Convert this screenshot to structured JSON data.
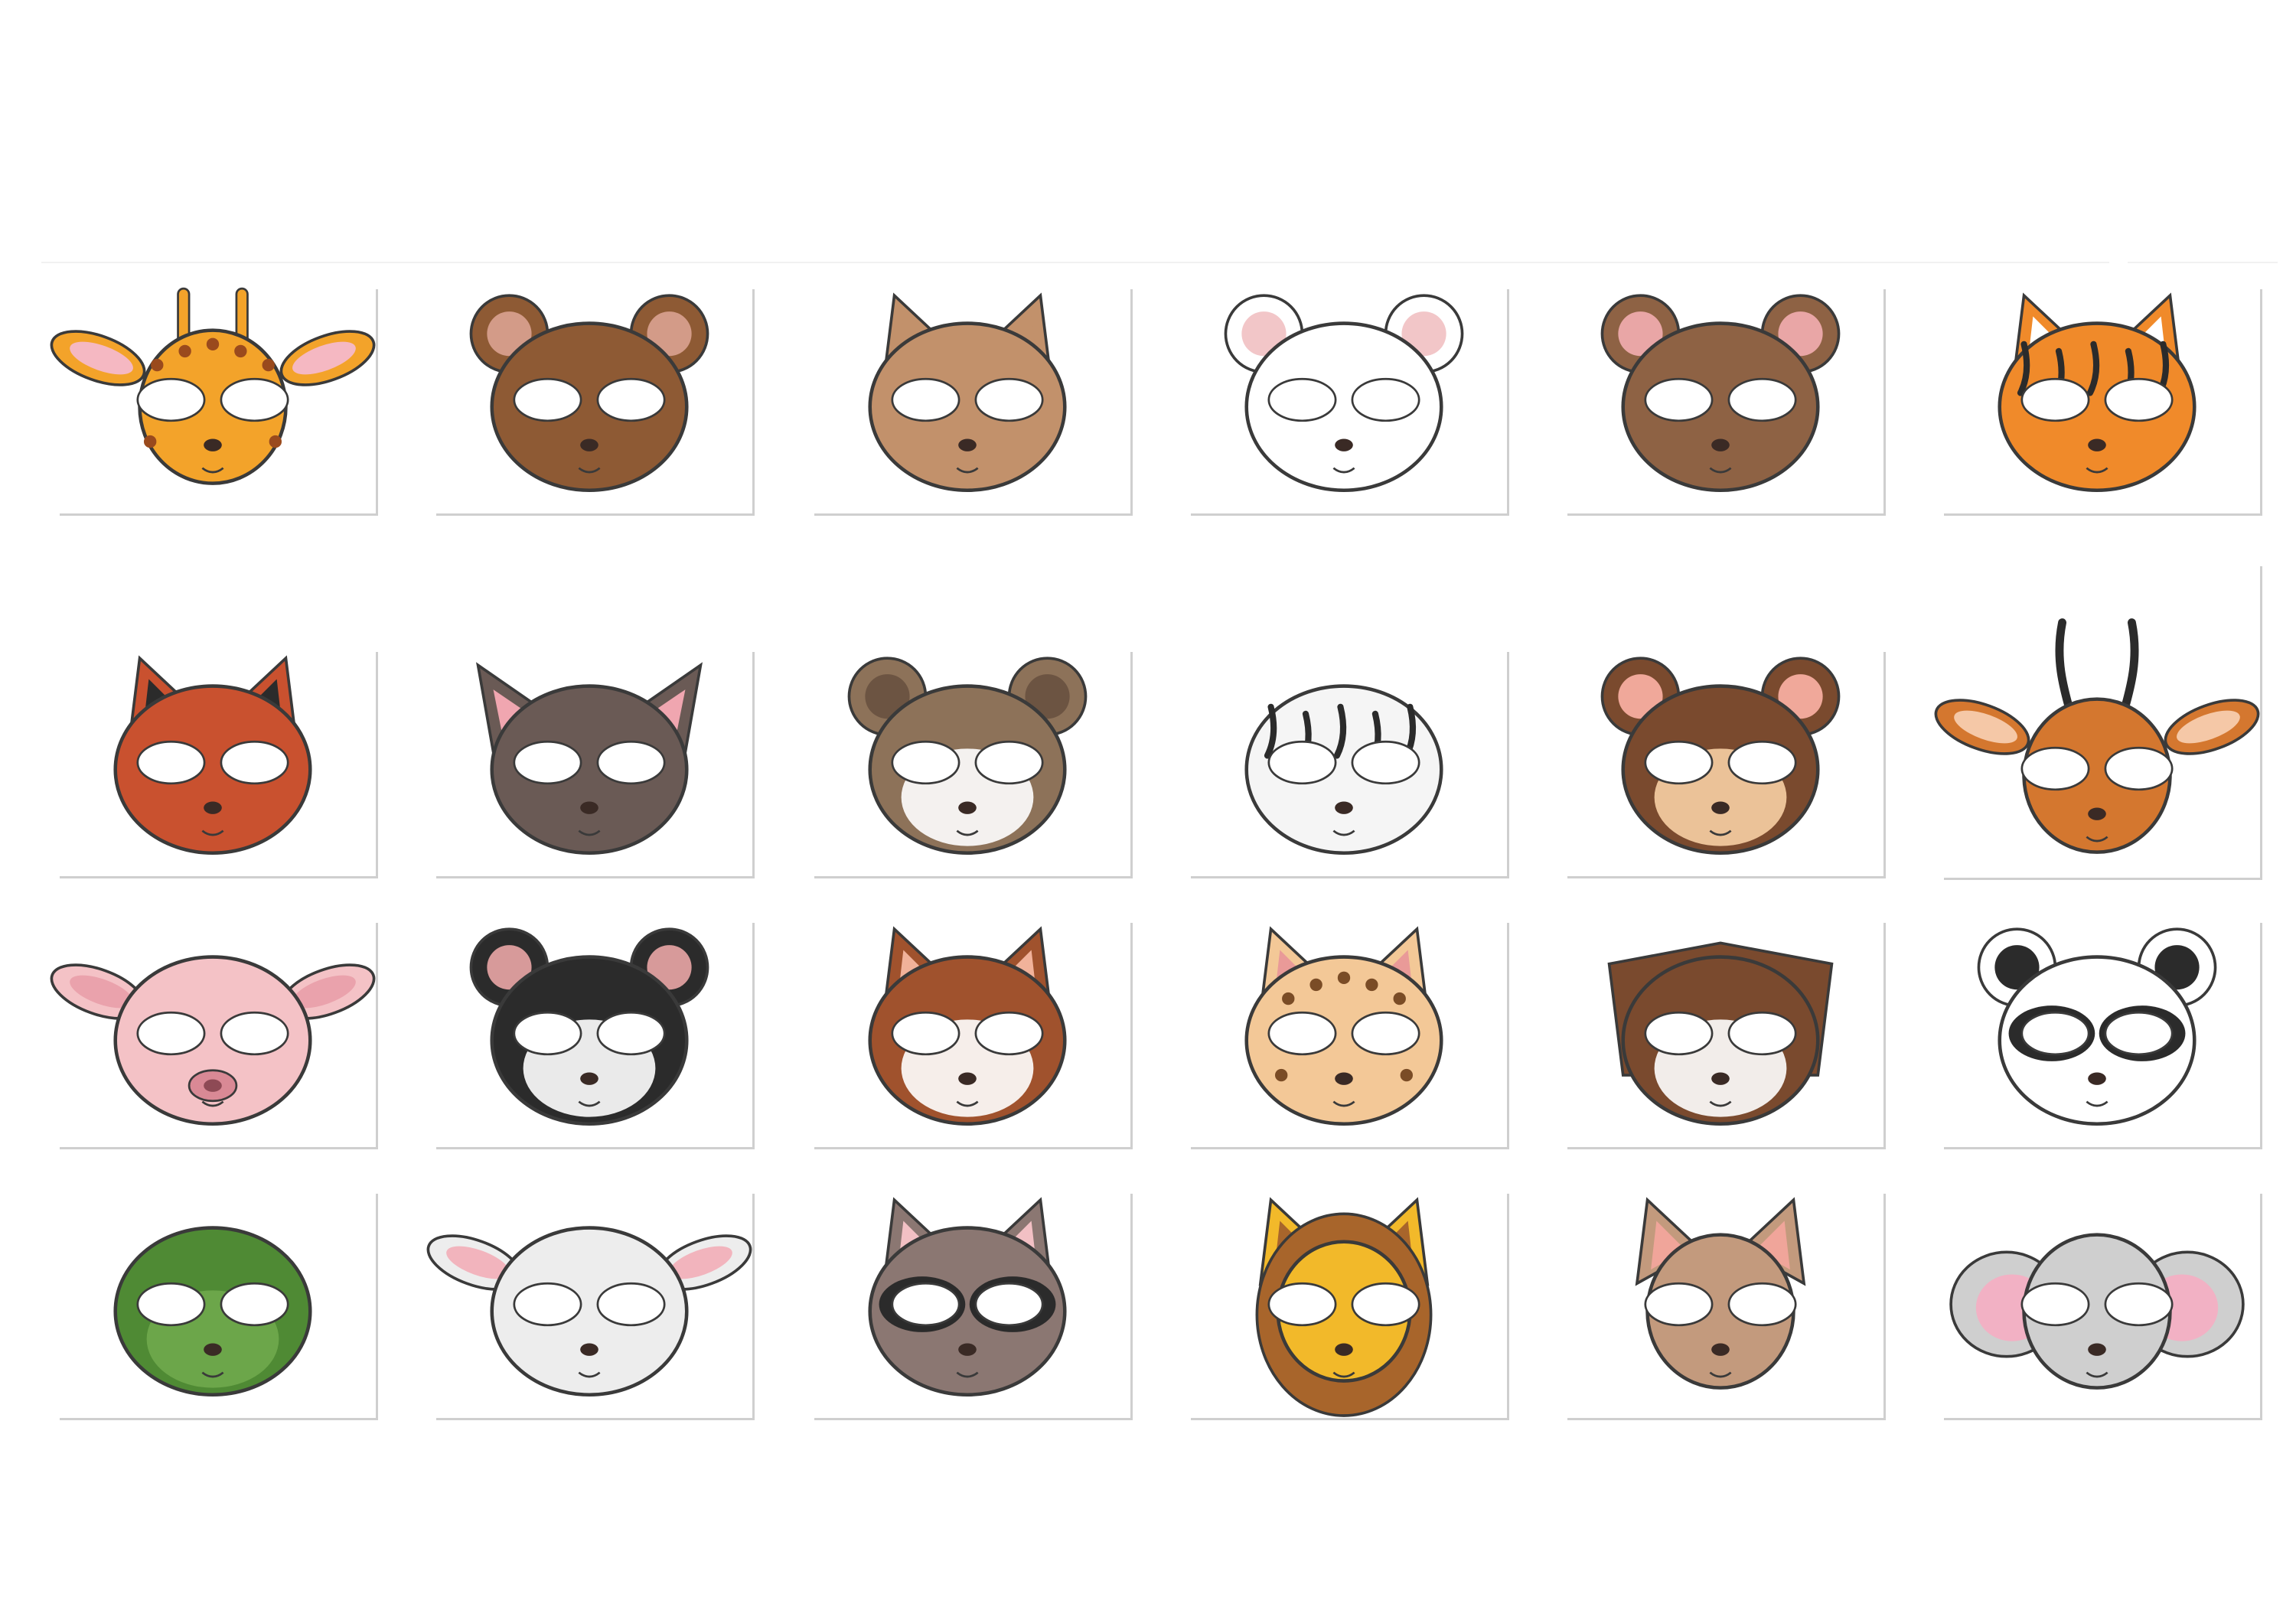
{
  "masks": [
    {
      "animal": "giraffe-mask",
      "base": "#f3a32a",
      "ear": "#f5b8c2",
      "dark": "#9a4a1d"
    },
    {
      "animal": "bear-mask",
      "base": "#8e5a34",
      "ear": "#d39b88",
      "dark": "#6e4024"
    },
    {
      "animal": "llama-mask",
      "base": "#c2916b",
      "ear": "#c2916b",
      "dark": "#8d6445"
    },
    {
      "animal": "polar-bear-mask",
      "base": "#ffffff",
      "ear": "#f2c6c8",
      "dark": "#d8d8d8"
    },
    {
      "animal": "beaver-mask",
      "base": "#8e6244",
      "ear": "#e9a6a6",
      "dark": "#6a462f"
    },
    {
      "animal": "tiger-mask",
      "base": "#f08a2a",
      "ear": "#ffffff",
      "dark": "#2b2b2b"
    },
    {
      "animal": "red-panda-mask",
      "base": "#c9512f",
      "ear": "#2b2b2b",
      "dark": "#8c3219"
    },
    {
      "animal": "bat-mask",
      "base": "#6a5a55",
      "ear": "#f0a6b0",
      "dark": "#4e413d"
    },
    {
      "animal": "otter-mask",
      "base": "#8d7259",
      "ear": "#6c5442",
      "dark": "#ffffff"
    },
    {
      "animal": "zebra-mask",
      "base": "#f5f5f5",
      "ear": "#f4b6c2",
      "dark": "#2b2b2b"
    },
    {
      "animal": "monkey-mask",
      "base": "#7a4a2e",
      "ear": "#f0a89a",
      "dark": "#f7cfa4"
    },
    {
      "animal": "gazelle-mask",
      "base": "#d4772f",
      "ear": "#f5c8a7",
      "dark": "#2b2b2b"
    },
    {
      "animal": "pig-mask",
      "base": "#f4c2c6",
      "ear": "#eaa2ac",
      "dark": "#d98995"
    },
    {
      "animal": "skunk-mask",
      "base": "#2b2b2b",
      "ear": "#d79a9a",
      "dark": "#ffffff"
    },
    {
      "animal": "fox-mask",
      "base": "#a0522d",
      "ear": "#f1b29a",
      "dark": "#ffffff"
    },
    {
      "animal": "leopard-mask",
      "base": "#f3c897",
      "ear": "#e99a98",
      "dark": "#7a4c26"
    },
    {
      "animal": "owl-mask",
      "base": "#7a4a2e",
      "ear": "#5a3520",
      "dark": "#ffffff"
    },
    {
      "animal": "panda-mask",
      "base": "#ffffff",
      "ear": "#2b2b2b",
      "dark": "#2b2b2b"
    },
    {
      "animal": "crocodile-mask",
      "base": "#4f8a34",
      "ear": "#3b6c25",
      "dark": "#f6b0b5"
    },
    {
      "animal": "sheep-mask",
      "base": "#ededed",
      "ear": "#f2b4bd",
      "dark": "#cfcfcf"
    },
    {
      "animal": "raccoon-mask",
      "base": "#8b7772",
      "ear": "#f2c0c4",
      "dark": "#2b2b2b"
    },
    {
      "animal": "lion-mask",
      "base": "#f2b92a",
      "ear": "#a8652b",
      "dark": "#8a4a20"
    },
    {
      "animal": "kangaroo-mask",
      "base": "#c39a7d",
      "ear": "#f0a59a",
      "dark": "#8f6a52"
    },
    {
      "animal": "elephant-mask",
      "base": "#cfcfcf",
      "ear": "#f2b1c4",
      "dark": "#a8a8a8"
    }
  ],
  "card_border_color": "#cfcfcf",
  "outline_color": "#3a3a3a"
}
